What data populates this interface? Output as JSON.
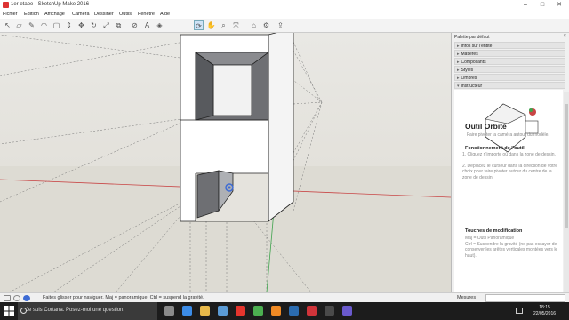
{
  "window": {
    "title": "1er etape - SketchUp Make 2016",
    "buttons": {
      "minimize": "–",
      "maximize": "□",
      "close": "✕"
    }
  },
  "menubar": {
    "items": [
      "Fichier",
      "Edition",
      "Affichage",
      "Caméra",
      "Dessiner",
      "Outils",
      "Fenêtre",
      "Aide"
    ]
  },
  "toolbar": {
    "tools": [
      {
        "icon": "arrow-select-icon",
        "glyph": "↖"
      },
      {
        "icon": "eraser-icon",
        "glyph": "▱"
      },
      {
        "icon": "pencil-line-icon",
        "glyph": "✎"
      },
      {
        "icon": "arc-icon",
        "glyph": "◠"
      },
      {
        "icon": "shape-icon",
        "glyph": "▢"
      },
      {
        "icon": "push-pull-icon",
        "glyph": "⇕"
      },
      {
        "icon": "move-icon",
        "glyph": "✥"
      },
      {
        "icon": "rotate-icon",
        "glyph": "↻"
      },
      {
        "icon": "scale-icon",
        "glyph": "⤢"
      },
      {
        "icon": "offset-icon",
        "glyph": "⧉"
      },
      {
        "icon": "tape-measure-icon",
        "glyph": "⊘"
      },
      {
        "icon": "text-icon",
        "glyph": "A"
      },
      {
        "icon": "paint-bucket-icon",
        "glyph": "◈"
      },
      {
        "icon": "orbit-icon",
        "glyph": "⟳"
      },
      {
        "icon": "pan-icon",
        "glyph": "✋"
      },
      {
        "icon": "zoom-icon",
        "glyph": "⌕"
      },
      {
        "icon": "zoom-extents-icon",
        "glyph": "⤧"
      },
      {
        "icon": "warehouse-icon",
        "glyph": "⌂"
      },
      {
        "icon": "extension-warehouse-icon",
        "glyph": "⚙"
      },
      {
        "icon": "share-model-icon",
        "glyph": "⇪"
      }
    ],
    "active_index": 13
  },
  "tray": {
    "title": "Palette par défaut",
    "close": "×",
    "sections": [
      {
        "label": "Infos sur l'entité"
      },
      {
        "label": "Matières"
      },
      {
        "label": "Composants"
      },
      {
        "label": "Styles"
      },
      {
        "label": "Ombres"
      },
      {
        "label": "Instructeur"
      }
    ],
    "instructor": {
      "tool_title": "Outil Orbite",
      "tool_desc": "Faire pivoter la caméra autour du modèle.",
      "section_function": "Fonctionnement de l'outil",
      "steps": [
        "1. Cliquez n'importe où dans la zone de dessin.",
        "2. Déplacez le curseur dans la direction de votre choix pour faire pivoter autour du centre de la zone de dessin."
      ],
      "section_keys": "Touches de modification",
      "keys": [
        "Maj = Outil Panoramique",
        "Ctrl = Suspendre la gravité (ne pas essayer de conserver les arêtes verticales montées vers le haut)."
      ]
    }
  },
  "status": {
    "text": "Faites glisser pour naviguer. Maj = panoramique, Ctrl = suspend la gravité.",
    "measures_label": "Mesures",
    "measures_value": ""
  },
  "taskbar": {
    "cortana_placeholder": "Je suis Cortana. Posez-moi une question.",
    "time": "18:15",
    "date": "22/05/2016",
    "apps": [
      {
        "icon": "task-view-icon",
        "color": "#8a8a8a"
      },
      {
        "icon": "edge-browser-icon",
        "color": "#3c8ce7"
      },
      {
        "icon": "file-explorer-icon",
        "color": "#e8b94a"
      },
      {
        "icon": "store-icon",
        "color": "#5b9bd5"
      },
      {
        "icon": "opera-icon",
        "color": "#e5352d"
      },
      {
        "icon": "chrome-icon",
        "color": "#4caf50"
      },
      {
        "icon": "vlc-icon",
        "color": "#f08a24"
      },
      {
        "icon": "app-icon",
        "color": "#2b6cb0"
      },
      {
        "icon": "sketchup-icon",
        "color": "#d0343a"
      },
      {
        "icon": "terminal-icon",
        "color": "#4a4a4a"
      },
      {
        "icon": "photos-icon",
        "color": "#6a5acd"
      }
    ]
  },
  "colors": {
    "viewport_bg": "#e5e3dd",
    "model_face": "#ffffff",
    "model_shade": "#6e6f73",
    "axis_red": "#c84545",
    "axis_green": "#3fa34d",
    "axis_blue": "#3d6bd4"
  }
}
